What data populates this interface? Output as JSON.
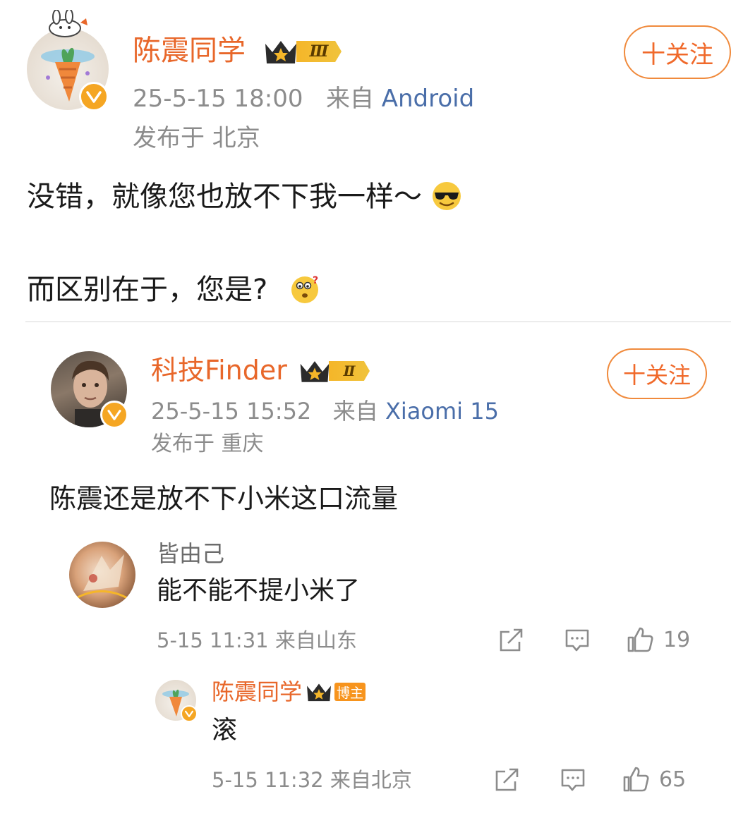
{
  "post": {
    "author": "陈震同学",
    "rank": "Ⅲ",
    "follow_label": "十关注",
    "time": "25-5-15 18:00",
    "from_label": "来自",
    "source": "Android",
    "location": "发布于 北京",
    "line1": "没错，就像您也放不下我一样～",
    "line2": "而区别在于，您是?"
  },
  "quoted": {
    "author": "科技Finder",
    "rank": "Ⅱ",
    "follow_label": "十关注",
    "time": "25-5-15 15:52",
    "from_label": "来自",
    "source": "Xiaomi 15",
    "location": "发布于 重庆",
    "content": "陈震还是放不下小米这口流量"
  },
  "comments": [
    {
      "author": "皆由己",
      "content": "能不能不提小米了",
      "meta": "5-15 11:31 来自山东",
      "likes": "19"
    },
    {
      "author": "陈震同学",
      "badge": "博主",
      "content": "滚",
      "meta": "5-15 11:32 来自北京",
      "likes": "65"
    }
  ],
  "icons": [
    "share-icon",
    "comment-icon",
    "like-icon",
    "verified-icon",
    "crown-icon",
    "sunglasses-emoji",
    "confused-emoji"
  ],
  "colors": {
    "name": "#e8672a",
    "follow": "#f0692a",
    "source": "#4a6ea9",
    "meta": "#8c8c8c",
    "badge": "#f5a623"
  }
}
